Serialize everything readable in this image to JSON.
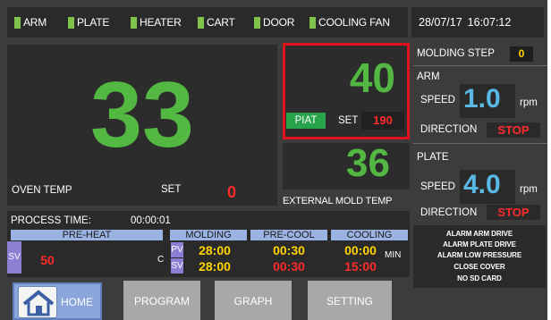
{
  "status_bar": {
    "indicators": [
      {
        "label": "ARM"
      },
      {
        "label": "PLATE"
      },
      {
        "label": "HEATER"
      },
      {
        "label": "CART"
      },
      {
        "label": "DOOR"
      },
      {
        "label": "COOLING FAN"
      }
    ],
    "indicator_color": "#7fc34a",
    "date": "28/07/17",
    "time": "16:07:12"
  },
  "oven": {
    "value": "33",
    "label": "OVEN TEMP",
    "set_label": "SET",
    "set_value": "0"
  },
  "mold": {
    "value": "40",
    "mode_button": "PIAT",
    "set_label": "SET",
    "set_value": "190",
    "highlight_color": "#e0121b"
  },
  "external_mold": {
    "value": "36",
    "label": "EXTERNAL MOLD TEMP"
  },
  "molding_step": {
    "label": "MOLDING STEP",
    "value": "0"
  },
  "arm": {
    "title": "ARM",
    "speed_label": "SPEED",
    "speed_value": "1.0",
    "speed_unit": "rpm",
    "direction_label": "DIRECTION",
    "direction_value": "STOP"
  },
  "plate": {
    "title": "PLATE",
    "speed_label": "SPEED",
    "speed_value": "4.0",
    "speed_unit": "rpm",
    "direction_label": "DIRECTION",
    "direction_value": "STOP"
  },
  "process": {
    "time_label": "PROCESS TIME:",
    "time_value": "00:00:01",
    "preheat": {
      "header": "PRE-HEAT",
      "sv_label": "SV",
      "value": "50",
      "unit": "C"
    },
    "molding": {
      "header": "MOLDING",
      "pv_label": "PV",
      "sv_label": "SV",
      "pv": "28:00",
      "sv": "28:00"
    },
    "precool": {
      "header": "PRE-COOL",
      "pv": "00:30",
      "sv": "00:30"
    },
    "cooling": {
      "header": "COOLING",
      "pv": "00:00",
      "sv": "15:00",
      "unit": "MIN"
    }
  },
  "alarms": [
    "ALARM ARM DRIVE",
    "ALARM PLATE DRIVE",
    "ALARM LOW PRESSURE",
    "CLOSE COVER",
    "NO SD CARD"
  ],
  "nav": {
    "home": "HOME",
    "program": "PROGRAM",
    "graph": "GRAPH",
    "setting": "SETTING"
  },
  "colors": {
    "value_green": "#52b842",
    "value_red": "#ff2a2a",
    "value_yellow": "#ffd400",
    "value_blue": "#59b8e6",
    "header_blue": "#9bb3e2",
    "pv_sv_purple": "#8a7fd3"
  }
}
